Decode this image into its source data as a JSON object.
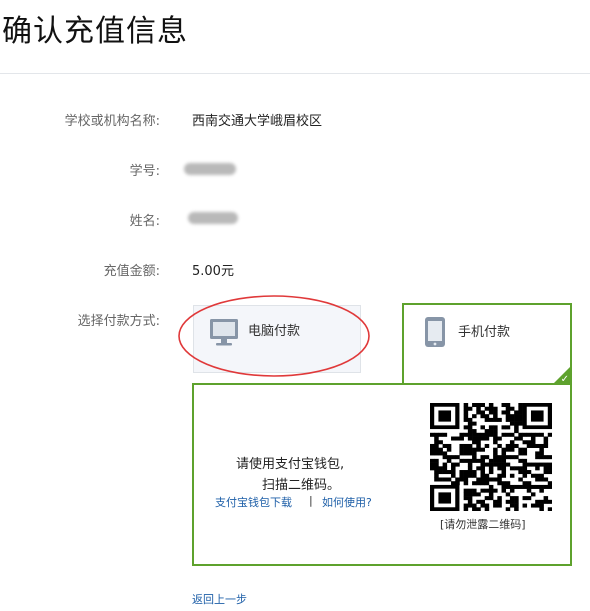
{
  "page": {
    "title": "确认充值信息"
  },
  "form": {
    "school_label": "学校或机构名称:",
    "school_value": "西南交通大学峨眉校区",
    "student_id_label": "学号:",
    "name_label": "姓名:",
    "amount_label": "充值金额:",
    "amount_value": "5.00元",
    "payment_label": "选择付款方式:"
  },
  "payment": {
    "pc_option_label": "电脑付款",
    "mobile_option_label": "手机付款",
    "selected": "mobile",
    "accent_color": "#5ea22d"
  },
  "qr_panel": {
    "instruction_line1": "请使用支付宝钱包,",
    "instruction_line2": "扫描二维码。",
    "download_link": "支付宝钱包下载",
    "separator": "|",
    "howto_link": "如何使用?",
    "warning": "[请勿泄露二维码]"
  },
  "footer": {
    "back_link": "返回上一步"
  },
  "icons": {
    "pc": "monitor-icon",
    "mobile": "tablet-icon",
    "selected": "checkmark-icon",
    "qr": "qr-code-icon"
  },
  "annotation": {
    "color": "#e0393a"
  }
}
